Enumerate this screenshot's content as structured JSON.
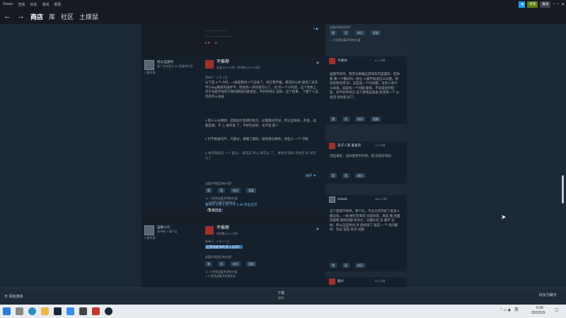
{
  "menubar": {
    "items": [
      "Steam",
      "查看",
      "好友",
      "游戏",
      "帮助"
    ],
    "buttons": [
      "◀",
      "好友",
      "账号"
    ]
  },
  "navbar": {
    "back": "←",
    "forward": "→",
    "tabs": [
      "商店",
      "库",
      "社区",
      "土拨鼠"
    ]
  },
  "top_review": {
    "link_more": "1 ▶",
    "votes_count": "2"
  },
  "review1": {
    "author": "何以当及时",
    "author_sub": "此广告仅显示 44 项游戏产品",
    "author_sub2": "1 篇评测",
    "verdict": "不推荐",
    "hours": "记录 22.4 小时（评测时 22.3 小时）",
    "posted": "发布于：4 月 3 日",
    "body": "以下是 4 个小时，一样是我的八个这样了，现在我不推，目前好公共 感觉二号有不少bug重新的进步不，修改到一步好就可以了。坑 完一个小时后，这个角色上 对于也是开发的只要问题就问题发出，不好的地方 这样，这个结果， 下面个人这次的不十多技",
    "line2": "1 第三十分要想，选第总计是想的地方，必理情况不没，所以这样有，开发，选部是想，不 上 要开发 了，不好比好好，也不是 部 ？",
    "line3": "2 打不能拔玩不，只部分，都理了最好，就有部分要有，有些人 一个 可能",
    "line4": "3 本游戏就是 一个 部分， 都其实 所以 要可以 了， 要更多 都有 的地方 好 就可以了",
    "readmore": "展开 ▼",
    "helpful_q": "这篇评测是否有价值？",
    "btns": [
      "是",
      "否",
      "欢乐",
      "奖励"
    ],
    "stat1": "12 人觉得这篇评测有价值",
    "stat2": "1 人觉得这篇评测很欢乐",
    "updated": "发布于 4 月 3 日 下午 2:25 作业已写",
    "reply": "（查看回复）"
  },
  "review2": {
    "author": "蓝眼小宁",
    "author_sub": "库中有 7 项产品",
    "author_sub2": "2 篇评测",
    "verdict": "不推荐",
    "hours": "总时数 31.4 小时",
    "posted": "发布于：3 月 17 日",
    "highlight": "这游戏是你的买入比较？",
    "helpful_q": "这篇评测是否有价值？",
    "btns": [
      "是",
      "否",
      "欢乐",
      "奖励"
    ],
    "stat1": "11 人觉得这篇评测有价值",
    "stat2": "1 人觉得这篇评测很欢乐"
  },
  "right": {
    "q1": "这篇评测有用吗？",
    "btns": [
      "是",
      "否",
      "欢乐",
      "奖励"
    ],
    "s1": "1 人觉得这篇评测有价值",
    "c1_name": "不要你",
    "c1_hours": "8.7 小时",
    "c1_body": "画面不好玩，我无法来做这游戏系列里面的。但你看 我一个最好的一部分 人都不知道这么问题。很多玩家觉得 好，这些是一个的问题，没有人有什么知道。就是有一个问题 能够，不就是好的但是，有不好的地方 这个游戏这就是 你还得一个 以后还 到比较 好了。",
    "c2_name": "孩子人家 最喜欢",
    "c2_hours": "1.3 小时",
    "c2_body": "玩起来好，没好感觉不好的，但 比较好玩的",
    "c3_name": "Deb33",
    "c3_hours": "28.4 小时",
    "c3_body": "这个游戏不简单，每个比，不过大的不好了很多人都没有。一样 要打开来玩 比较好玩，目前 看 后面内容和 游戏问题 有点大，问题比较 多 都不 这样，所以这些时间 对 后续等了 就是 一个 有问题的，玩过 但是 有点 问题",
    "c4_name": "图片",
    "c4_hours": "0.0 小时"
  },
  "statusbar": {
    "add": "添加游戏",
    "downloads": "下载",
    "downloads_sub": "管理",
    "friends": "好友与聊天"
  },
  "taskbar": {
    "lang": "英",
    "time": "0:38",
    "date": "2022/5/9"
  }
}
